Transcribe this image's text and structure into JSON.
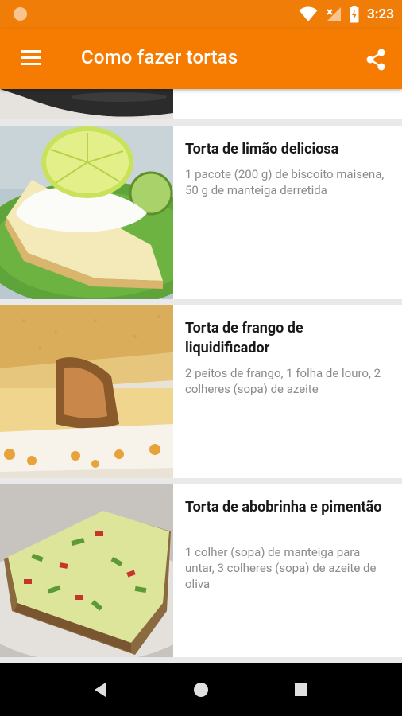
{
  "status_bar": {
    "time": "3:23"
  },
  "app_bar": {
    "title": "Como fazer tortas"
  },
  "recipes": [
    {
      "title": "Torta de limão deliciosa",
      "description": "1 pacote (200 g) de biscoito maisena, 50 g de manteiga derretida"
    },
    {
      "title": "Torta de frango de liquidificador",
      "description": "2 peitos de frango, 1 folha de louro, 2 colheres (sopa) de azeite"
    },
    {
      "title": "Torta de abobrinha e pimentão",
      "description": "1 colher (sopa) de manteiga para untar, 3 colheres (sopa) de azeite de oliva"
    }
  ],
  "colors": {
    "status_bar": "#ef7d07",
    "app_bar": "#f57c00",
    "navigation_bar": "#000000",
    "card_background": "#ffffff",
    "list_background": "#e9e9e9"
  },
  "icons": {
    "menu": "hamburger-menu-icon",
    "share": "share-icon",
    "back": "back-triangle-icon",
    "home": "home-circle-icon",
    "recents": "recents-square-icon"
  }
}
